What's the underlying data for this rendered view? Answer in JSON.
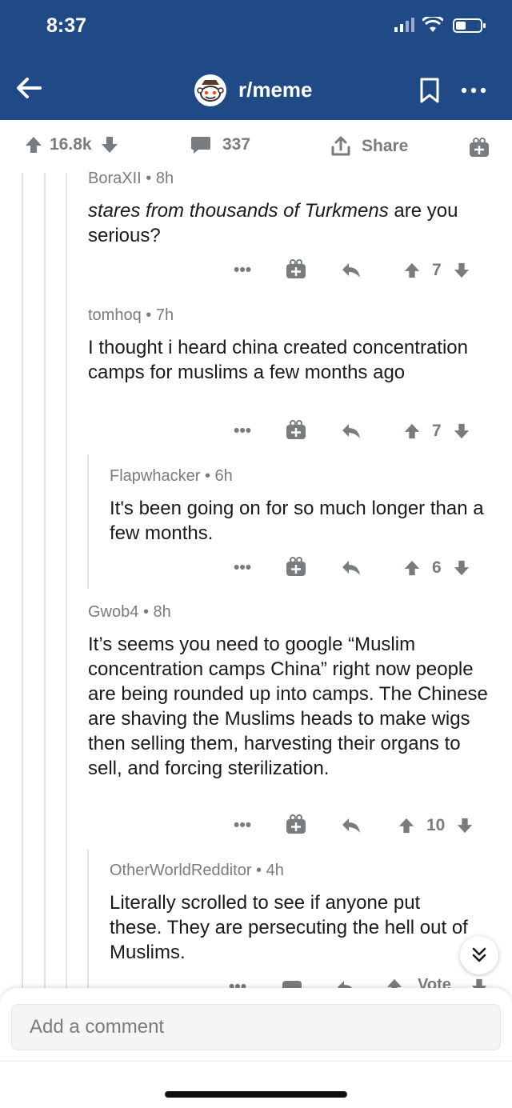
{
  "status_bar": {
    "time": "8:37"
  },
  "header": {
    "subreddit": "r/meme",
    "colors": {
      "header_bg": "#1f4a85",
      "text": "#ffffff"
    },
    "icons": [
      "back-arrow-icon",
      "subreddit-avatar-icon",
      "bookmark-icon",
      "more-dots-icon"
    ]
  },
  "post_bar": {
    "score": "16.8k",
    "comments": "337",
    "share_label": "Share"
  },
  "comments": [
    {
      "author": "BoraXII",
      "age": "8h",
      "body_italic": "stares from thousands of Turkmens",
      "body_rest": " are you serious?",
      "score": "7"
    },
    {
      "author": "tomhoq",
      "age": "7h",
      "body": "I thought i heard china created concentration camps for muslims a few months ago",
      "score": "7"
    },
    {
      "author": "Flapwhacker",
      "age": "6h",
      "body": "It's been going on for so much longer than a few months.",
      "score": "6"
    },
    {
      "author": "Gwob4",
      "age": "8h",
      "body": "It’s seems you need to google “Muslim concentration camps China” right now people are being rounded up into camps. The Chinese are shaving the Muslims heads to make wigs then selling them, harvesting their organs to sell, and forcing sterilization.",
      "score": "10"
    },
    {
      "author": "OtherWorldRedditor",
      "age": "4h",
      "body": "Literally scrolled to see if anyone put these. They are persecuting the hell out of Muslims.",
      "score": "Vote"
    }
  ],
  "meta_separator": "•",
  "more_label": "•••",
  "comment_box": {
    "placeholder": "Add a comment"
  },
  "colors": {
    "muted": "#787c7e",
    "text": "#1a1a1b",
    "thread_line": "#e3e3e3"
  }
}
